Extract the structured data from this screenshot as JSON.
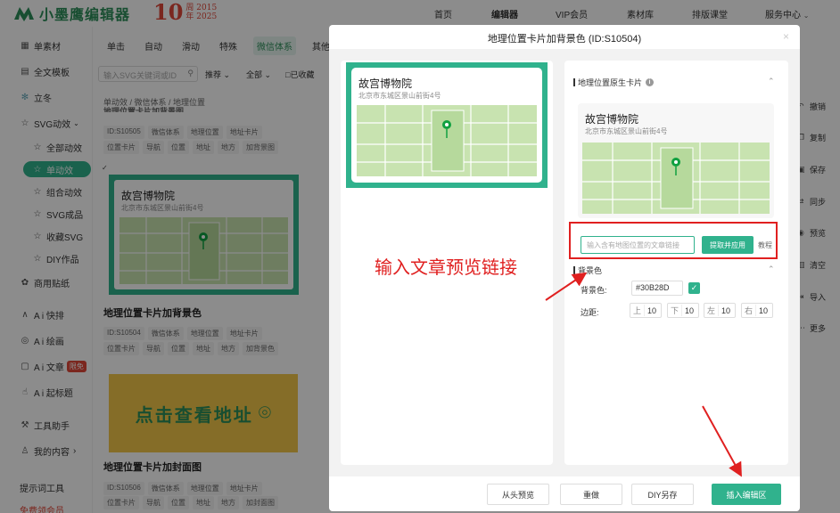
{
  "header": {
    "logo_text": "小墨鹰编辑器",
    "anniv_num": "10",
    "anniv_line1": "周 2015",
    "anniv_line2": "年 2025",
    "nav": [
      "首页",
      "编辑器",
      "VIP会员",
      "素材库",
      "排版课堂",
      "服务中心"
    ],
    "nav_dropdown": "⌄"
  },
  "sidebar": {
    "items": [
      {
        "label": "单素材",
        "icon": "grid-icon"
      },
      {
        "label": "全文模板",
        "icon": "layout-icon"
      },
      {
        "label": "立冬",
        "icon": "snowflake-icon"
      },
      {
        "label": "SVG动效",
        "icon": "star-icon"
      },
      {
        "label": "全部动效",
        "icon": "star-outline-icon"
      },
      {
        "label": "单动效",
        "icon": "star-outline-icon"
      },
      {
        "label": "组合动效",
        "icon": "star-outline-icon"
      },
      {
        "label": "SVG成品",
        "icon": "star-outline-icon"
      },
      {
        "label": "收藏SVG",
        "icon": "star-outline-icon"
      },
      {
        "label": "DIY作品",
        "icon": "star-outline-icon"
      },
      {
        "label": "商用贴纸",
        "icon": "sticker-icon"
      },
      {
        "label": "A i 快排",
        "icon": "ai-icon"
      },
      {
        "label": "A i 绘画",
        "icon": "palette-icon"
      },
      {
        "label": "A i 文章",
        "icon": "doc-icon"
      },
      {
        "label": "A i 起标题",
        "icon": "hand-icon"
      },
      {
        "label": "工具助手",
        "icon": "tool-icon"
      },
      {
        "label": "我的内容",
        "icon": "user-icon"
      },
      {
        "label": "提示词工具",
        "icon": ""
      },
      {
        "label": "免费领会员",
        "icon": ""
      }
    ],
    "ai_article_badge": "限免",
    "chev_right": "›",
    "chev_down": "⌄"
  },
  "content": {
    "tabs": [
      "单击",
      "自动",
      "滑动",
      "特殊",
      "微信体系",
      "其他"
    ],
    "search_placeholder": "输入SVG关键词或ID",
    "filters": [
      "推荐",
      "全部",
      "已收藏"
    ],
    "breadcrumb": "单动效 / 微信体系 / 地理位置",
    "cards": [
      {
        "id": "ID:S10505",
        "tags1": [
          "微信体系",
          "地理位置",
          "地址卡片"
        ],
        "tags2": [
          "位置卡片",
          "导航",
          "位置",
          "地址",
          "地方",
          "加背景图"
        ]
      },
      {
        "title": "地理位置卡片加背景色",
        "id": "ID:S10504",
        "tags1": [
          "微信体系",
          "地理位置",
          "地址卡片"
        ],
        "tags2": [
          "位置卡片",
          "导航",
          "位置",
          "地址",
          "地方",
          "加背景色"
        ]
      },
      {
        "title": "地理位置卡片加封面图",
        "id": "ID:S10506",
        "tags1": [
          "微信体系",
          "地理位置",
          "地址卡片"
        ],
        "tags2": [
          "位置卡片",
          "导航",
          "位置",
          "地址",
          "地方",
          "加封面图"
        ]
      }
    ],
    "promo_text": "点击查看地址",
    "partial_top_title": "地理位置卡片加背景图"
  },
  "location": {
    "name": "故宫博物院",
    "address": "北京市东城区景山前街4号"
  },
  "right_toolbar": [
    "撤销",
    "复制",
    "保存",
    "同步",
    "预览",
    "清空",
    "导入",
    "更多"
  ],
  "modal": {
    "title": "地理位置卡片加背景色 (ID:S10504)",
    "close": "×",
    "section_native": "地理位置原生卡片",
    "url_placeholder": "输入含有地图位置的文章链接",
    "fetch_button": "提取并应用",
    "tutorial": "教程",
    "section_bg": "背景色",
    "bg_label": "背景色:",
    "bg_value": "#30B28D",
    "check": "✓",
    "margin_label": "边距:",
    "margins": [
      {
        "k": "上",
        "v": "10"
      },
      {
        "k": "下",
        "v": "10"
      },
      {
        "k": "左",
        "v": "10"
      },
      {
        "k": "右",
        "v": "10"
      }
    ],
    "footer": [
      "从头预览",
      "重做",
      "DIY另存",
      "插入编辑区"
    ],
    "collapse_icon": "⌃"
  },
  "annotation": "输入文章预览链接",
  "colors": {
    "accent": "#30B28D",
    "red": "#E02020"
  }
}
